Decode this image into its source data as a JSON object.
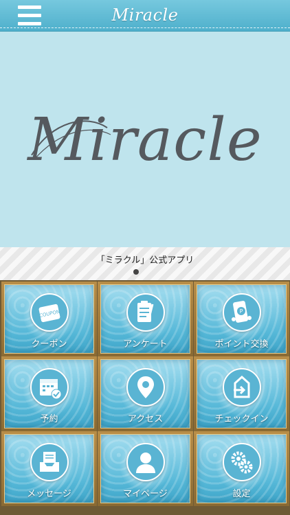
{
  "header": {
    "title": "Miracle",
    "menu_icon": "hamburger-menu-icon"
  },
  "hero": {
    "logo_text": "Miracle"
  },
  "caption": {
    "text": "「ミラクル」公式アプリ",
    "carousel_pages": 1,
    "carousel_current": 1
  },
  "tiles": [
    {
      "label": "クーポン",
      "icon": "coupon-icon"
    },
    {
      "label": "アンケート",
      "icon": "survey-clipboard-icon"
    },
    {
      "label": "ポイント交換",
      "icon": "point-exchange-icon"
    },
    {
      "label": "予約",
      "icon": "calendar-check-icon"
    },
    {
      "label": "アクセス",
      "icon": "map-pin-icon"
    },
    {
      "label": "チェックイン",
      "icon": "check-in-door-icon"
    },
    {
      "label": "メッセージ",
      "icon": "message-inbox-icon"
    },
    {
      "label": "マイページ",
      "icon": "user-profile-icon"
    },
    {
      "label": "設定",
      "icon": "gear-settings-icon"
    }
  ],
  "colors": {
    "header": "#5ab9d4",
    "hero_background": "#bfe4ed",
    "tile_frame": "#9b7a3e",
    "icon_fill": "#5ab4d3"
  }
}
